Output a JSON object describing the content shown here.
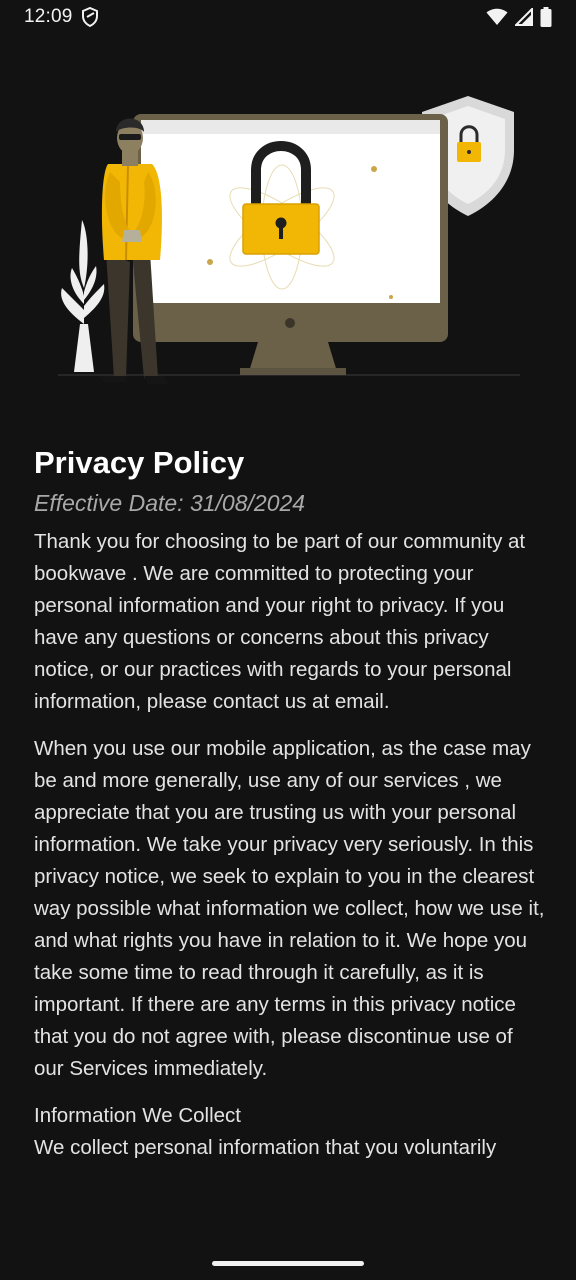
{
  "status_bar": {
    "time": "12:09",
    "icons": [
      "privacy-shield-icon",
      "wifi-icon",
      "cellular-signal-icon",
      "battery-icon"
    ]
  },
  "illustration": {
    "name": "privacy-illustration",
    "description_icons": [
      "person-figure",
      "monitor",
      "padlock-icon",
      "shield-lock-icon",
      "plant"
    ],
    "accent_color": "#f2b705"
  },
  "content": {
    "title": "Privacy Policy",
    "effective_date": "Effective Date: 31/08/2024",
    "paragraphs": [
      "Thank you for choosing to be part of our community at bookwave . We are committed to protecting your personal information and your right to privacy. If you have any questions or concerns about this privacy notice, or our practices with regards to your personal information, please contact us at email.",
      "When you use our mobile application, as the case may be and more generally, use any of our services , we appreciate that you are trusting us with your personal information. We take your privacy very seriously. In this privacy notice, we seek to explain to you in the clearest way possible what information we collect, how we use it, and what rights you have in relation to it. We hope you take some time to read through it carefully, as it is important. If there are any terms in this privacy notice that you do not agree with, please discontinue use of our Services immediately."
    ],
    "section_heading": "Information We Collect",
    "section_text": "We collect personal information that you voluntarily"
  },
  "colors": {
    "background": "#121212",
    "text": "#e3e3e3",
    "muted": "#a9a9a9",
    "accent": "#f2b705"
  }
}
